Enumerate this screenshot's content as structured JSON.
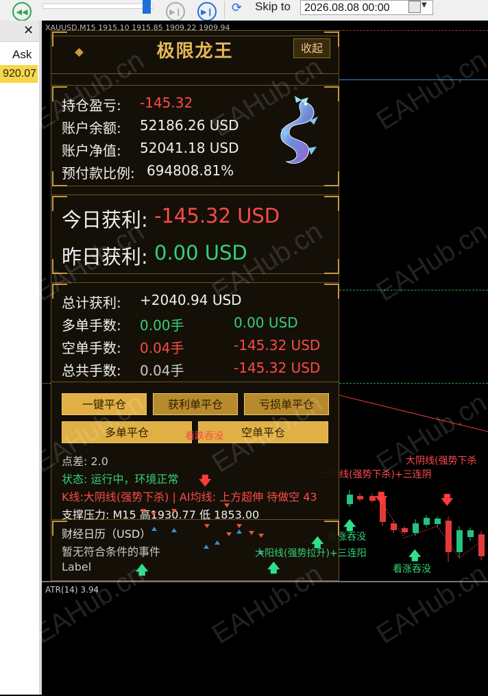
{
  "toolbar": {
    "skip_label": "Skip to",
    "date_value": "2026.08.08 00:00"
  },
  "market_watch": {
    "ask_label": "Ask",
    "ask_value": "920.07",
    "close_glyph": "✕"
  },
  "chart": {
    "title": "XAUUSD,M15  1915.10 1915.85 1909.22 1909.94",
    "indicator_label": "ATR(14) 3.94",
    "colors": {
      "up": "#26c281",
      "down": "#e03b3b",
      "bg": "#000000"
    }
  },
  "panel": {
    "title": "极限龙王",
    "collapse_label": "收起",
    "account": {
      "pnl_label": "持仓盈亏:",
      "pnl_value": "-145.32",
      "balance_label": "账户余额:",
      "balance_value": "52186.26 USD",
      "equity_label": "账户净值:",
      "equity_value": "52041.18 USD",
      "margin_label": "预付款比例:",
      "margin_value": "694808.81%"
    },
    "daily": {
      "today_label": "今日获利:",
      "today_value": "-145.32 USD",
      "yesterday_label": "昨日获利:",
      "yesterday_value": "0.00 USD"
    },
    "totals": {
      "total_label": "总计获利:",
      "total_value": "+2040.94 USD",
      "buy_label": "多单手数:",
      "buy_lots": "0.00手",
      "buy_usd": "0.00 USD",
      "sell_label": "空单手数:",
      "sell_lots": "0.04手",
      "sell_usd": "-145.32 USD",
      "all_label": "总共手数:",
      "all_lots": "0.04手",
      "all_usd": "-145.32 USD"
    },
    "buttons": {
      "close_all": "一键平仓",
      "close_profit": "获利单平仓",
      "close_loss": "亏损单平仓",
      "close_buy": "多单平仓",
      "close_sell": "空单平仓"
    },
    "info": {
      "spread": "点差: 2.0",
      "status": "状态: 运行中，环境正常",
      "signal": "K线:大阴线(强势下杀) | AI均线: 上方超伸 待做空 43",
      "sr": "支撑压力: M15 高1930.77  低 1853.00"
    },
    "calendar": {
      "title": "财经日历（USD）",
      "none": "暂无符合条件的事件",
      "label": "Label"
    }
  },
  "annotations": {
    "bearish_engulf": "看跌吞没",
    "big_bear_top": "大阴线(强势下杀",
    "big_bear_three": "大阴线(强势下杀)+三连阴",
    "bull_engulf_1": "看涨吞没",
    "big_bull_three": "大阳线(强势拉升)+三连阳",
    "bull_engulf_2": "看涨吞没"
  },
  "watermark": "EAHub.cn"
}
